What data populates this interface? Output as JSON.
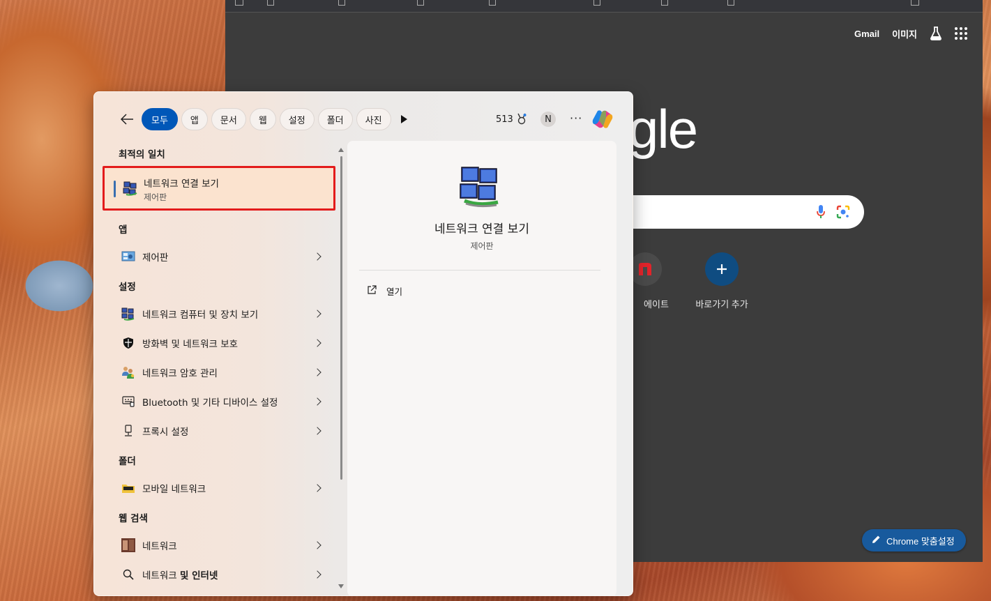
{
  "chrome": {
    "top_links": {
      "gmail": "Gmail",
      "images": "이미지"
    },
    "logo_text": "gle",
    "shortcuts": [
      {
        "label": "에이트",
        "icon": "n-logo-icon"
      },
      {
        "label": "바로가기 추가",
        "icon": "plus-icon"
      }
    ],
    "customize_label": "Chrome 맞춤설정"
  },
  "search_panel": {
    "filter_chips": [
      "모두",
      "앱",
      "문서",
      "웹",
      "설정",
      "폴더",
      "사진"
    ],
    "active_chip": "모두",
    "points": "513",
    "avatar_initial": "N",
    "more_label": "···",
    "best_match": {
      "section": "최적의 일치",
      "title": "네트워크 연결 보기",
      "subtitle": "제어판"
    },
    "sections": {
      "apps": "앱",
      "settings": "설정",
      "folders": "폴더",
      "web": "웹 검색"
    },
    "apps": [
      {
        "label": "제어판",
        "icon": "control-panel-icon"
      }
    ],
    "settings": [
      {
        "label": "네트워크 컴퓨터 및 장치 보기",
        "icon": "network-icon"
      },
      {
        "label": "방화벽 및 네트워크 보호",
        "icon": "shield-icon"
      },
      {
        "label": "네트워크 암호 관리",
        "icon": "users-key-icon"
      },
      {
        "label": "Bluetooth 및 기타 디바이스 설정",
        "icon": "devices-icon"
      },
      {
        "label": "프록시 설정",
        "icon": "proxy-icon"
      }
    ],
    "folders": [
      {
        "label": "모바일 네트워크",
        "icon": "folder-icon"
      }
    ],
    "web": [
      {
        "label": "네트워크",
        "icon": "web-thumb-icon"
      },
      {
        "label_prefix": "네트워크 ",
        "label_bold": "및 인터넷",
        "icon": "search-icon"
      }
    ],
    "detail": {
      "title": "네트워크 연결 보기",
      "subtitle": "제어판",
      "action_open": "열기"
    }
  },
  "colors": {
    "accent": "#0057b8",
    "highlight_border": "#e31b1b",
    "chrome_bg": "#3c3c3c"
  }
}
